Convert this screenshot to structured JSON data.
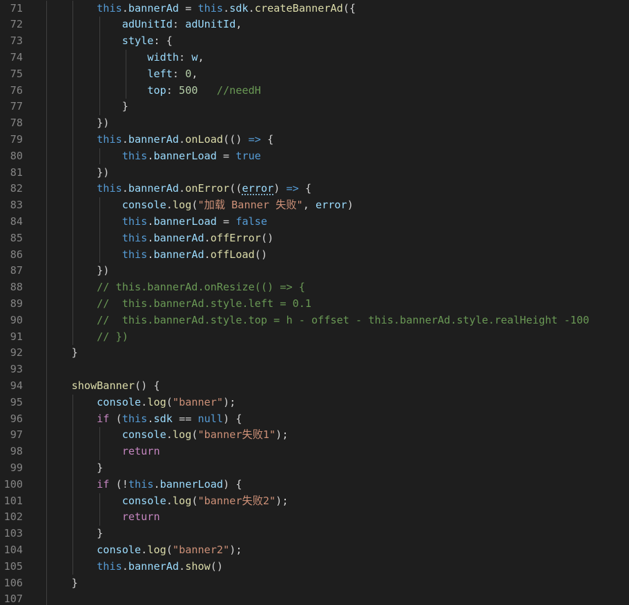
{
  "editor": {
    "colors": {
      "background": "#1e1e1e",
      "line_number": "#858585",
      "plain": "#d4d4d4",
      "keyword": "#569cd6",
      "control": "#c586c0",
      "variable": "#9cdcfe",
      "function": "#dcdcaa",
      "string": "#ce9178",
      "number": "#b5cea8",
      "comment": "#6a9955",
      "indent_guide": "#404040"
    },
    "lines": [
      {
        "num": "71",
        "indent": 2,
        "tokens": [
          [
            "kw",
            "this"
          ],
          [
            "plain",
            "."
          ],
          [
            "var",
            "bannerAd"
          ],
          [
            "plain",
            " = "
          ],
          [
            "kw",
            "this"
          ],
          [
            "plain",
            "."
          ],
          [
            "var",
            "sdk"
          ],
          [
            "plain",
            "."
          ],
          [
            "fn",
            "createBannerAd"
          ],
          [
            "plain",
            "({"
          ]
        ]
      },
      {
        "num": "72",
        "indent": 3,
        "tokens": [
          [
            "var",
            "adUnitId"
          ],
          [
            "plain",
            ": "
          ],
          [
            "var",
            "adUnitId"
          ],
          [
            "plain",
            ","
          ]
        ]
      },
      {
        "num": "73",
        "indent": 3,
        "tokens": [
          [
            "var",
            "style"
          ],
          [
            "plain",
            ": {"
          ]
        ]
      },
      {
        "num": "74",
        "indent": 4,
        "tokens": [
          [
            "var",
            "width"
          ],
          [
            "plain",
            ": "
          ],
          [
            "var",
            "w"
          ],
          [
            "plain",
            ","
          ]
        ]
      },
      {
        "num": "75",
        "indent": 4,
        "tokens": [
          [
            "var",
            "left"
          ],
          [
            "plain",
            ": "
          ],
          [
            "num",
            "0"
          ],
          [
            "plain",
            ","
          ]
        ]
      },
      {
        "num": "76",
        "indent": 4,
        "tokens": [
          [
            "var",
            "top"
          ],
          [
            "plain",
            ": "
          ],
          [
            "num",
            "500"
          ],
          [
            "plain",
            "   "
          ],
          [
            "cmt",
            "//needH"
          ]
        ]
      },
      {
        "num": "77",
        "indent": 3,
        "tokens": [
          [
            "plain",
            "}"
          ]
        ]
      },
      {
        "num": "78",
        "indent": 2,
        "tokens": [
          [
            "plain",
            "})"
          ]
        ]
      },
      {
        "num": "79",
        "indent": 2,
        "tokens": [
          [
            "kw",
            "this"
          ],
          [
            "plain",
            "."
          ],
          [
            "var",
            "bannerAd"
          ],
          [
            "plain",
            "."
          ],
          [
            "fn",
            "onLoad"
          ],
          [
            "plain",
            "(() "
          ],
          [
            "kw",
            "=>"
          ],
          [
            "plain",
            " {"
          ]
        ]
      },
      {
        "num": "80",
        "indent": 3,
        "tokens": [
          [
            "kw",
            "this"
          ],
          [
            "plain",
            "."
          ],
          [
            "var",
            "bannerLoad"
          ],
          [
            "plain",
            " = "
          ],
          [
            "kw",
            "true"
          ]
        ]
      },
      {
        "num": "81",
        "indent": 2,
        "tokens": [
          [
            "plain",
            "})"
          ]
        ]
      },
      {
        "num": "82",
        "indent": 2,
        "tokens": [
          [
            "kw",
            "this"
          ],
          [
            "plain",
            "."
          ],
          [
            "var",
            "bannerAd"
          ],
          [
            "plain",
            "."
          ],
          [
            "fn",
            "onError"
          ],
          [
            "plain",
            "(("
          ],
          [
            "param",
            "error"
          ],
          [
            "plain",
            ") "
          ],
          [
            "kw",
            "=>"
          ],
          [
            "plain",
            " {"
          ]
        ]
      },
      {
        "num": "83",
        "indent": 3,
        "tokens": [
          [
            "var",
            "console"
          ],
          [
            "plain",
            "."
          ],
          [
            "fn",
            "log"
          ],
          [
            "plain",
            "("
          ],
          [
            "str",
            "\"加载 Banner 失败\""
          ],
          [
            "plain",
            ", "
          ],
          [
            "var",
            "error"
          ],
          [
            "plain",
            ")"
          ]
        ]
      },
      {
        "num": "84",
        "indent": 3,
        "tokens": [
          [
            "kw",
            "this"
          ],
          [
            "plain",
            "."
          ],
          [
            "var",
            "bannerLoad"
          ],
          [
            "plain",
            " = "
          ],
          [
            "kw",
            "false"
          ]
        ]
      },
      {
        "num": "85",
        "indent": 3,
        "tokens": [
          [
            "kw",
            "this"
          ],
          [
            "plain",
            "."
          ],
          [
            "var",
            "bannerAd"
          ],
          [
            "plain",
            "."
          ],
          [
            "fn",
            "offError"
          ],
          [
            "plain",
            "()"
          ]
        ]
      },
      {
        "num": "86",
        "indent": 3,
        "tokens": [
          [
            "kw",
            "this"
          ],
          [
            "plain",
            "."
          ],
          [
            "var",
            "bannerAd"
          ],
          [
            "plain",
            "."
          ],
          [
            "fn",
            "offLoad"
          ],
          [
            "plain",
            "()"
          ]
        ]
      },
      {
        "num": "87",
        "indent": 2,
        "tokens": [
          [
            "plain",
            "})"
          ]
        ]
      },
      {
        "num": "88",
        "indent": 2,
        "tokens": [
          [
            "cmt",
            "// this.bannerAd.onResize(() => {"
          ]
        ]
      },
      {
        "num": "89",
        "indent": 2,
        "tokens": [
          [
            "cmt",
            "//  this.bannerAd.style.left = 0.1"
          ]
        ]
      },
      {
        "num": "90",
        "indent": 2,
        "tokens": [
          [
            "cmt",
            "//  this.bannerAd.style.top = h - offset - this.bannerAd.style.realHeight -100"
          ]
        ]
      },
      {
        "num": "91",
        "indent": 2,
        "tokens": [
          [
            "cmt",
            "// })"
          ]
        ]
      },
      {
        "num": "92",
        "indent": 1,
        "tokens": [
          [
            "plain",
            "}"
          ]
        ]
      },
      {
        "num": "93",
        "indent": 1,
        "tokens": []
      },
      {
        "num": "94",
        "indent": 1,
        "tokens": [
          [
            "fn",
            "showBanner"
          ],
          [
            "plain",
            "() {"
          ]
        ]
      },
      {
        "num": "95",
        "indent": 2,
        "tokens": [
          [
            "var",
            "console"
          ],
          [
            "plain",
            "."
          ],
          [
            "fn",
            "log"
          ],
          [
            "plain",
            "("
          ],
          [
            "str",
            "\"banner\""
          ],
          [
            "plain",
            ");"
          ]
        ]
      },
      {
        "num": "96",
        "indent": 2,
        "tokens": [
          [
            "ctrl",
            "if"
          ],
          [
            "plain",
            " ("
          ],
          [
            "kw",
            "this"
          ],
          [
            "plain",
            "."
          ],
          [
            "var",
            "sdk"
          ],
          [
            "plain",
            " == "
          ],
          [
            "kw",
            "null"
          ],
          [
            "plain",
            ") {"
          ]
        ]
      },
      {
        "num": "97",
        "indent": 3,
        "tokens": [
          [
            "var",
            "console"
          ],
          [
            "plain",
            "."
          ],
          [
            "fn",
            "log"
          ],
          [
            "plain",
            "("
          ],
          [
            "str",
            "\"banner失败1\""
          ],
          [
            "plain",
            ");"
          ]
        ]
      },
      {
        "num": "98",
        "indent": 3,
        "tokens": [
          [
            "ctrl",
            "return"
          ]
        ]
      },
      {
        "num": "99",
        "indent": 2,
        "tokens": [
          [
            "plain",
            "}"
          ]
        ]
      },
      {
        "num": "100",
        "indent": 2,
        "tokens": [
          [
            "ctrl",
            "if"
          ],
          [
            "plain",
            " (!"
          ],
          [
            "kw",
            "this"
          ],
          [
            "plain",
            "."
          ],
          [
            "var",
            "bannerLoad"
          ],
          [
            "plain",
            ") {"
          ]
        ]
      },
      {
        "num": "101",
        "indent": 3,
        "tokens": [
          [
            "var",
            "console"
          ],
          [
            "plain",
            "."
          ],
          [
            "fn",
            "log"
          ],
          [
            "plain",
            "("
          ],
          [
            "str",
            "\"banner失败2\""
          ],
          [
            "plain",
            ");"
          ]
        ]
      },
      {
        "num": "102",
        "indent": 3,
        "tokens": [
          [
            "ctrl",
            "return"
          ]
        ]
      },
      {
        "num": "103",
        "indent": 2,
        "tokens": [
          [
            "plain",
            "}"
          ]
        ]
      },
      {
        "num": "104",
        "indent": 2,
        "tokens": [
          [
            "var",
            "console"
          ],
          [
            "plain",
            "."
          ],
          [
            "fn",
            "log"
          ],
          [
            "plain",
            "("
          ],
          [
            "str",
            "\"banner2\""
          ],
          [
            "plain",
            ");"
          ]
        ]
      },
      {
        "num": "105",
        "indent": 2,
        "tokens": [
          [
            "kw",
            "this"
          ],
          [
            "plain",
            "."
          ],
          [
            "var",
            "bannerAd"
          ],
          [
            "plain",
            "."
          ],
          [
            "fn",
            "show"
          ],
          [
            "plain",
            "()"
          ]
        ]
      },
      {
        "num": "106",
        "indent": 1,
        "tokens": [
          [
            "plain",
            "}"
          ]
        ]
      },
      {
        "num": "107",
        "indent": 1,
        "tokens": []
      }
    ]
  }
}
